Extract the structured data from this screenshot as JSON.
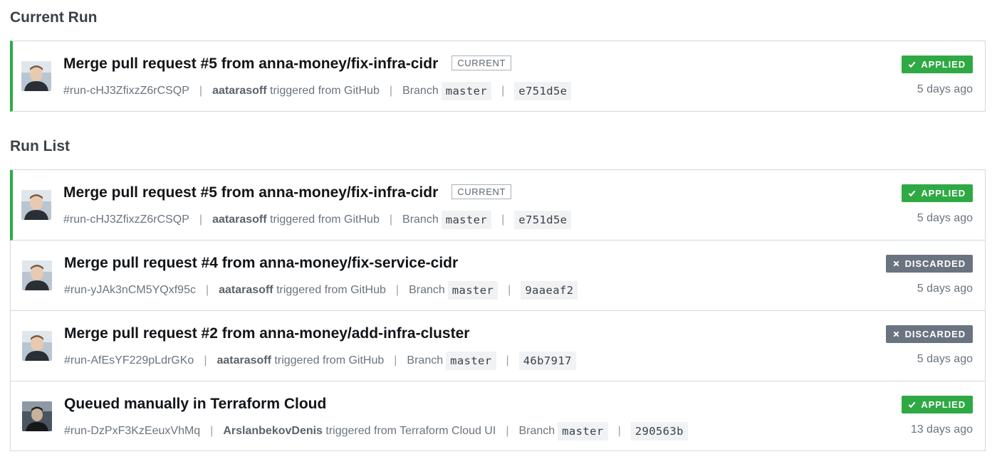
{
  "sections": {
    "current_title": "Current Run",
    "runlist_title": "Run List"
  },
  "current_run": {
    "title": "Merge pull request #5 from anna-money/fix-infra-cidr",
    "badge": "CURRENT",
    "run_id": "#run-cHJ3ZfixzZ6rCSQP",
    "user": "aatarasoff",
    "trigger_text": "triggered from GitHub",
    "branch_label": "Branch",
    "branch": "master",
    "commit": "e751d5e",
    "status": "APPLIED",
    "time": "5 days ago"
  },
  "runs": [
    {
      "title": "Merge pull request #5 from anna-money/fix-infra-cidr",
      "badge": "CURRENT",
      "run_id": "#run-cHJ3ZfixzZ6rCSQP",
      "user": "aatarasoff",
      "trigger_text": "triggered from GitHub",
      "branch_label": "Branch",
      "branch": "master",
      "commit": "e751d5e",
      "status": "APPLIED",
      "time": "5 days ago"
    },
    {
      "title": "Merge pull request #4 from anna-money/fix-service-cidr",
      "run_id": "#run-yJAk3nCM5YQxf95c",
      "user": "aatarasoff",
      "trigger_text": "triggered from GitHub",
      "branch_label": "Branch",
      "branch": "master",
      "commit": "9aaeaf2",
      "status": "DISCARDED",
      "time": "5 days ago"
    },
    {
      "title": "Merge pull request #2 from anna-money/add-infra-cluster",
      "run_id": "#run-AfEsYF229pLdrGKo",
      "user": "aatarasoff",
      "trigger_text": "triggered from GitHub",
      "branch_label": "Branch",
      "branch": "master",
      "commit": "46b7917",
      "status": "DISCARDED",
      "time": "5 days ago"
    },
    {
      "title": "Queued manually in Terraform Cloud",
      "run_id": "#run-DzPxF3KzEeuxVhMq",
      "user": "ArslanbekovDenis",
      "trigger_text": "triggered from Terraform Cloud UI",
      "branch_label": "Branch",
      "branch": "master",
      "commit": "290563b",
      "status": "APPLIED",
      "time": "13 days ago"
    }
  ],
  "colors": {
    "applied": "#2fa944",
    "discarded": "#6a7480",
    "current_border": "#2eaa4b"
  },
  "icons": {
    "applied": "check-icon",
    "discarded": "x-icon",
    "avatar": "user-avatar"
  }
}
